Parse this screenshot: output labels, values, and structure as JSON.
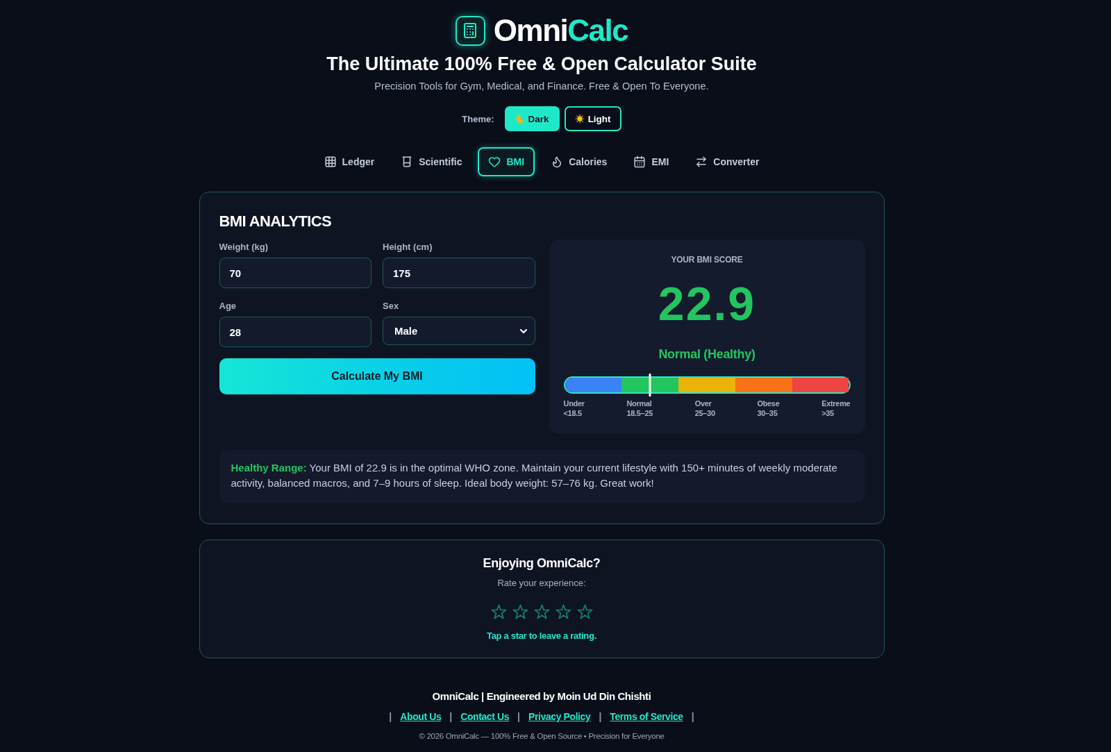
{
  "header": {
    "logo": {
      "name_start": "Omni",
      "name_accent": "Calc"
    },
    "headline": "The Ultimate 100% Free & Open Calculator Suite",
    "tagline": "Precision Tools for Gym, Medical, and Finance. Free & Open To Everyone."
  },
  "theme": {
    "label": "Theme:",
    "options": [
      {
        "label": "Dark",
        "selected": true
      },
      {
        "label": "Light",
        "selected": false
      }
    ]
  },
  "tabs": [
    {
      "label": "Ledger",
      "selected": false
    },
    {
      "label": "Scientific",
      "selected": false
    },
    {
      "label": "BMI",
      "selected": true
    },
    {
      "label": "Calories",
      "selected": false
    },
    {
      "label": "EMI",
      "selected": false
    },
    {
      "label": "Converter",
      "selected": false
    }
  ],
  "bmi_card": {
    "title": "BMI ANALYTICS",
    "fields": [
      {
        "kind": "input",
        "label": "Weight (kg)",
        "value": "70"
      },
      {
        "kind": "input",
        "label": "Height (cm)",
        "value": "175"
      },
      {
        "kind": "input",
        "label": "Age",
        "value": "28"
      },
      {
        "kind": "select",
        "label": "Sex",
        "value": "Male"
      }
    ],
    "button": "Calculate My BMI",
    "result": {
      "heading": "YOUR BMI SCORE",
      "score": "22.9",
      "category": "Normal (Healthy)",
      "scale": {
        "level": 0.3,
        "segments": [
          {
            "label": "Under",
            "range": "<18.5",
            "color": "#3b82f6"
          },
          {
            "label": "Normal",
            "range": "18.5–25",
            "color": "#22c55e"
          },
          {
            "label": "Over",
            "range": "25–30",
            "color": "#eab308"
          },
          {
            "label": "Obese",
            "range": "30–35",
            "color": "#f97316"
          },
          {
            "label": "Extreme",
            "range": ">35",
            "color": "#ef4444"
          }
        ]
      }
    },
    "advice": "**Healthy Range:** Your BMI of 22.9 is in the optimal WHO zone. Maintain your current lifestyle with 150+ minutes of weekly moderate activity, balanced macros, and 7–9 hours of sleep. Ideal body weight: 57–76 kg. Great work!"
  },
  "rating": {
    "title": "Enjoying OmniCalc?",
    "prompt": "Rate your experience:",
    "stars": 0,
    "hint": "Tap a star to leave a rating."
  },
  "footer": {
    "credit": "OmniCalc | Engineered by Moin Ud Din Chishti",
    "links": [
      {
        "kind": "separator",
        "text": "|"
      },
      {
        "kind": "link",
        "text": "About Us"
      },
      {
        "kind": "separator",
        "text": "|"
      },
      {
        "kind": "link",
        "text": "Contact Us"
      },
      {
        "kind": "separator",
        "text": "|"
      },
      {
        "kind": "link",
        "text": "Privacy Policy"
      },
      {
        "kind": "separator",
        "text": "|"
      },
      {
        "kind": "link",
        "text": "Terms of Service"
      },
      {
        "kind": "separator",
        "text": "|"
      }
    ],
    "copyright": "© 2026 OmniCalc — 100% Free & Open Source • Precision for Everyone"
  }
}
